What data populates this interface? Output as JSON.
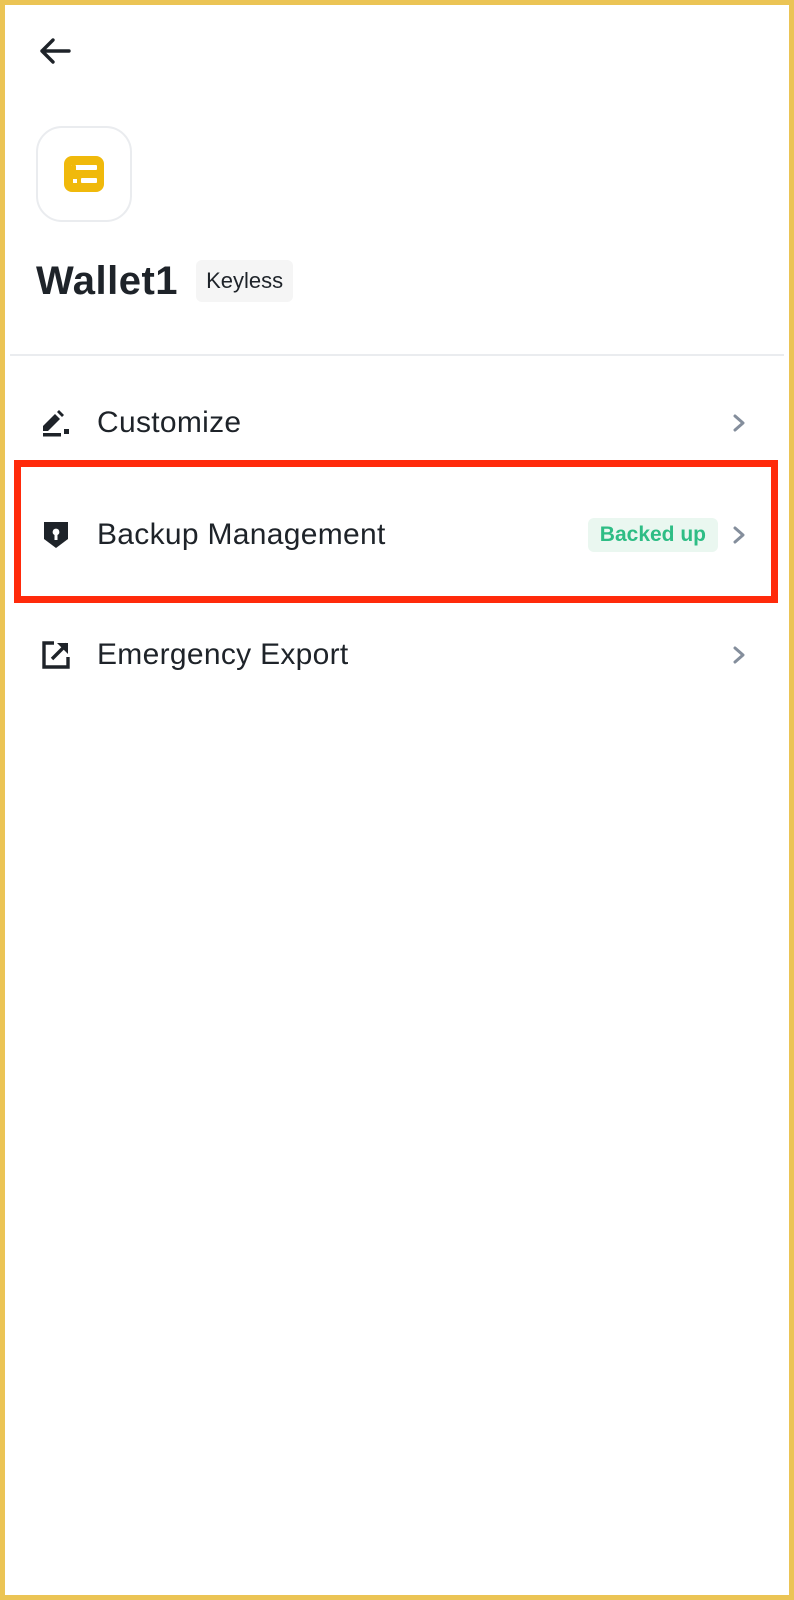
{
  "header": {
    "back_icon": "arrow-left-icon"
  },
  "wallet": {
    "avatar_icon": "wallet-card-icon",
    "avatar_color": "#f0b90b",
    "name": "Wallet1",
    "type_badge": "Keyless"
  },
  "menu": {
    "items": [
      {
        "label": "Customize",
        "icon": "edit-pen-icon",
        "badge": ""
      },
      {
        "label": "Backup Management",
        "icon": "shield-lock-icon",
        "badge": "Backed up"
      },
      {
        "label": "Emergency Export",
        "icon": "export-arrow-icon",
        "badge": ""
      }
    ]
  },
  "colors": {
    "border_frame": "#ebc455",
    "highlight": "#ff2a0b",
    "badge_text": "#2ebd85",
    "badge_bg": "#eaf7f0",
    "text_primary": "#1e2329",
    "chevron": "#848e9c"
  }
}
